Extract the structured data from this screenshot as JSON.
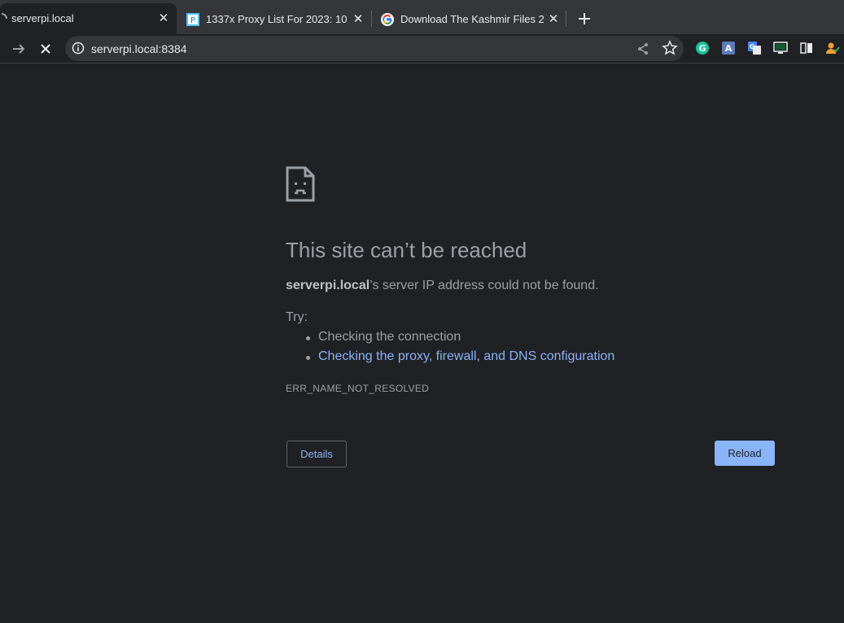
{
  "tabs": [
    {
      "title": "serverpi.local",
      "active": true,
      "favicon": "loading-spinner-icon"
    },
    {
      "title": "1337x Proxy List For 2023: 10",
      "active": false,
      "favicon": "proxy-site-icon"
    },
    {
      "title": "Download The Kashmir Files 2",
      "active": false,
      "favicon": "google-icon"
    }
  ],
  "toolbar": {
    "url": "serverpi.local:8384"
  },
  "extensions": [
    "grammarly-icon",
    "translate-font-icon",
    "google-translate-icon",
    "monitor-icon",
    "reading-list-icon",
    "profile-check-icon"
  ],
  "error": {
    "heading": "This site can’t be reached",
    "host": "serverpi.local",
    "message": "’s server IP address could not be found.",
    "try_label": "Try:",
    "suggestions": [
      {
        "text": "Checking the connection",
        "link": false
      },
      {
        "text": "Checking the proxy, firewall, and DNS configuration",
        "link": true
      }
    ],
    "code": "ERR_NAME_NOT_RESOLVED",
    "details_label": "Details",
    "reload_label": "Reload"
  },
  "colors": {
    "background": "#202124",
    "tabstrip": "#35363a",
    "link": "#8ab4f8",
    "text": "#9aa0a6"
  }
}
